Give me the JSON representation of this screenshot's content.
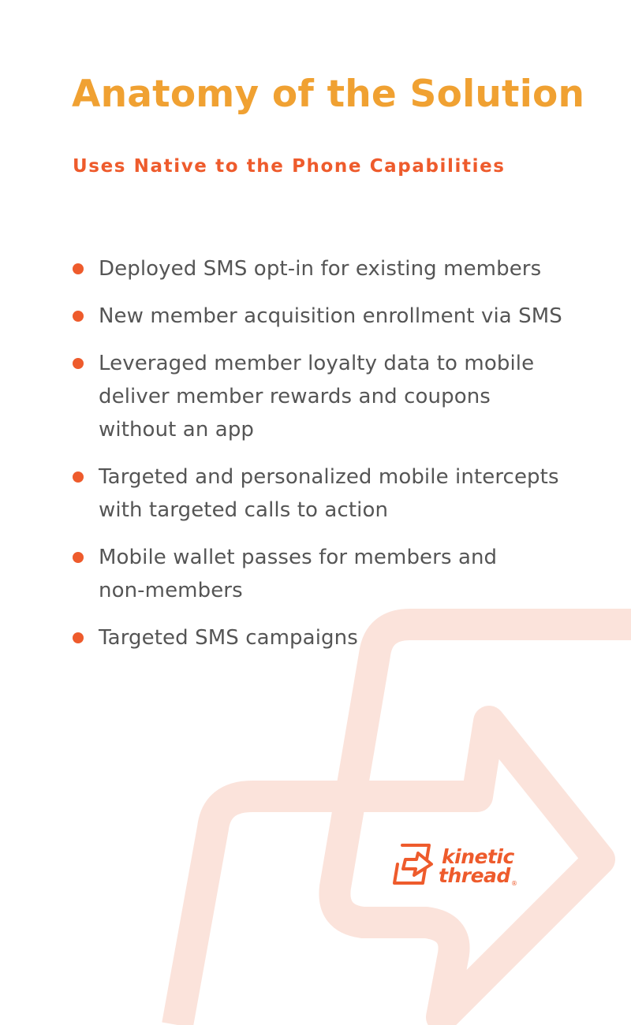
{
  "colors": {
    "title": "#F0A132",
    "accent": "#EE5B2C",
    "body_text": "#555555",
    "arrow_bg": "#FBE3DB"
  },
  "header": {
    "title": "Anatomy of the Solution",
    "subtitle": "Uses Native to the Phone Capabilities"
  },
  "bullets": [
    {
      "lines": [
        "Deployed SMS opt-in for existing members"
      ]
    },
    {
      "lines": [
        "New member acquisition enrollment via SMS"
      ]
    },
    {
      "lines": [
        "Leveraged member loyalty data to mobile",
        "deliver member rewards and coupons",
        "without an app"
      ]
    },
    {
      "lines": [
        "Targeted and personalized mobile intercepts",
        "with targeted calls to action"
      ]
    },
    {
      "lines": [
        "Mobile wallet passes for members and",
        "non-members"
      ]
    },
    {
      "lines": [
        "Targeted SMS campaigns"
      ]
    }
  ],
  "logo": {
    "line1": "kinetic",
    "line2": "thread",
    "registered": "®",
    "icon": "arrow-box-icon"
  }
}
